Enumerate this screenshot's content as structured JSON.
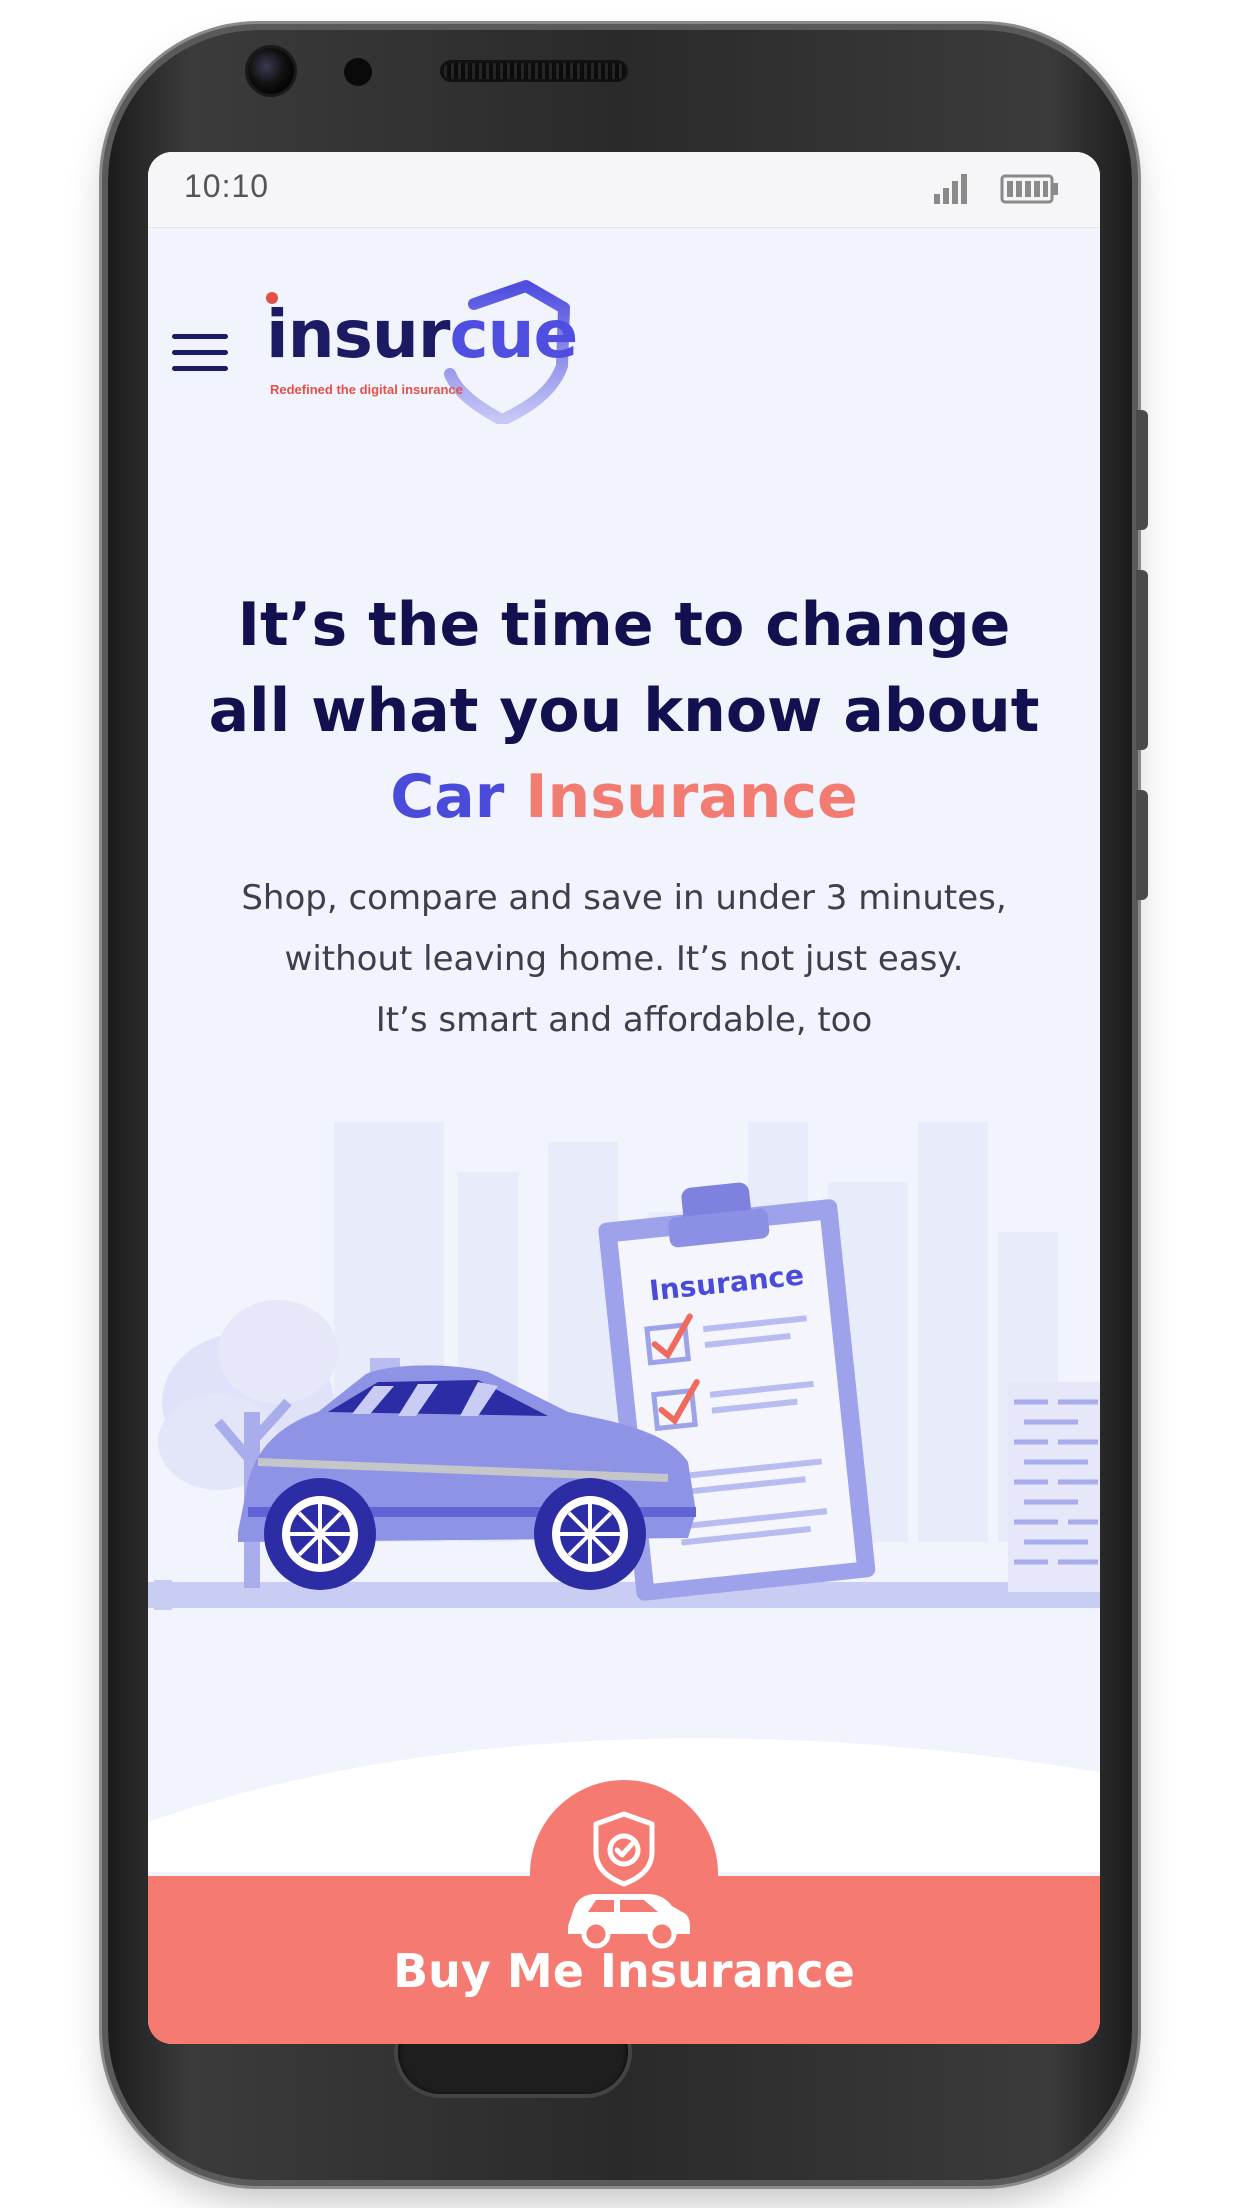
{
  "status_bar": {
    "time": "10:10",
    "signal_icon": "signal-bars-icon",
    "battery_icon": "battery-icon"
  },
  "header": {
    "menu_icon": "hamburger-menu-icon",
    "logo": {
      "word_part1": "insur",
      "word_part2": "cue",
      "tagline": "Redefined the digital insurance"
    }
  },
  "hero": {
    "title_line1": "It’s the time to change",
    "title_line2": "all what you know about",
    "title_highlight1": "Car",
    "title_highlight2": "Insurance",
    "subtitle_line1": "Shop, compare and save in under 3 minutes,",
    "subtitle_line2": "without leaving home. It’s not just easy.",
    "subtitle_line3": "It’s smart and affordable, too"
  },
  "illustration": {
    "clipboard_title": "Insurance"
  },
  "cta": {
    "label": "Buy Me Insurance",
    "icon": "shield-car-icon"
  },
  "colors": {
    "navy": "#12104e",
    "brand_blue": "#4b4bdb",
    "coral": "#f57b72",
    "screen_bg": "#f2f4fd"
  }
}
